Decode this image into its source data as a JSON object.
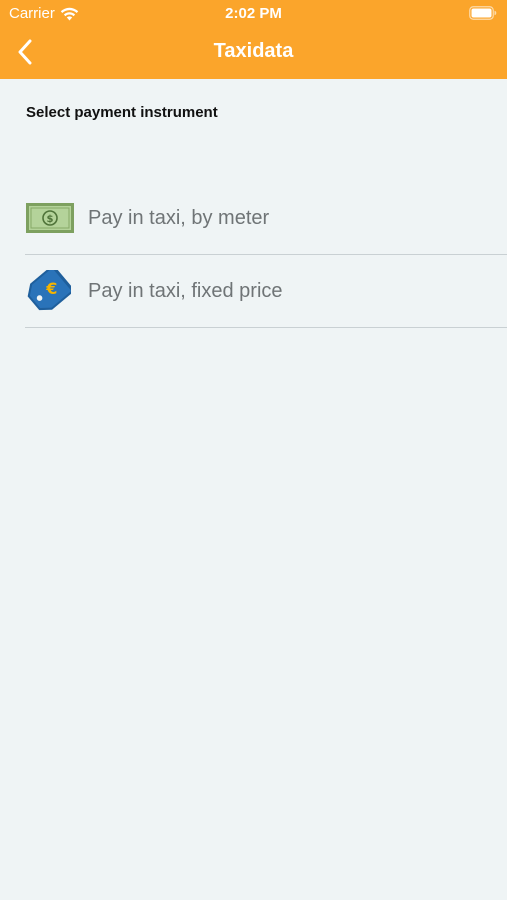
{
  "status_bar": {
    "carrier": "Carrier",
    "time": "2:02 PM"
  },
  "nav": {
    "title": "Taxidata",
    "back_icon": "chevron-left-icon"
  },
  "section": {
    "header": "Select payment instrument"
  },
  "payment_options": [
    {
      "label": "Pay in taxi, by meter",
      "icon": "banknote-icon"
    },
    {
      "label": "Pay in taxi, fixed price",
      "icon": "euro-price-tag-icon"
    }
  ],
  "colors": {
    "accent": "#fba52b",
    "background": "#eff4f5",
    "item_text": "#6f7476",
    "divider": "#c9d0d3"
  }
}
